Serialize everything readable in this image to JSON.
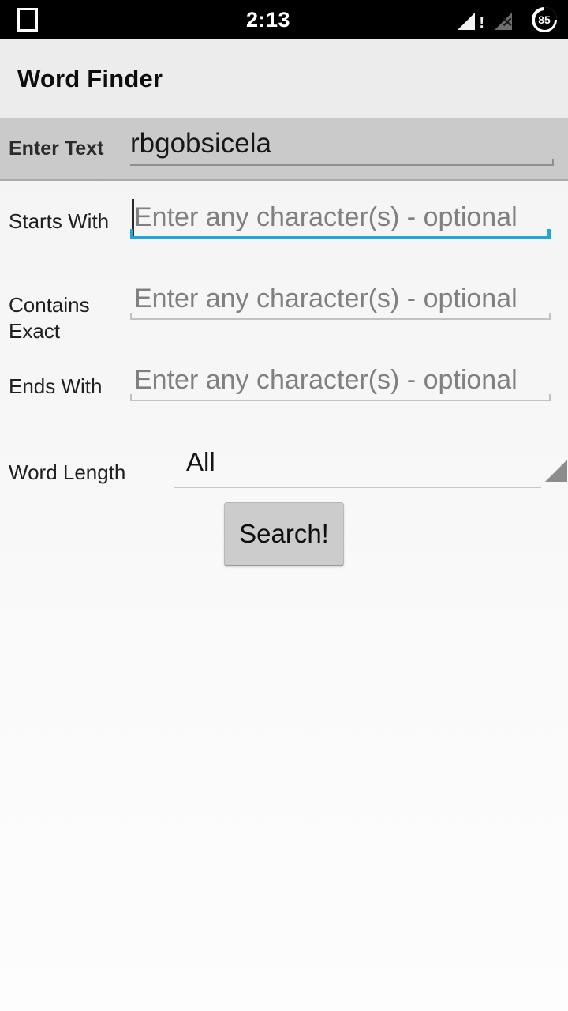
{
  "status_bar": {
    "recents_icon": "square-outline-icon",
    "clock": "2:13",
    "signal_icon": "signal-warning-icon",
    "signal_warning_glyph": "!",
    "signal_secondary_icon": "signal-no-service-icon",
    "signal_secondary_glyph": "✕",
    "battery_icon": "battery-circle-icon",
    "battery_level": "85",
    "background_color": "#000000"
  },
  "action_bar": {
    "title": "Word Finder",
    "background_color": "#ececec"
  },
  "enter_text_row": {
    "label": "Enter Text",
    "value": "rbgobsicela",
    "background_color": "#cacaca"
  },
  "form": {
    "placeholder": "Enter any character(s) - optional",
    "focus_color": "#25a4d8",
    "rows": [
      {
        "label": "Starts With",
        "value": "",
        "focused": true
      },
      {
        "label": "Contains Exact",
        "value": "",
        "focused": false
      },
      {
        "label": "Ends With",
        "value": "",
        "focused": false
      }
    ],
    "word_length": {
      "label": "Word Length",
      "selected": "All",
      "dropdown_icon": "spinner-triangle-icon"
    },
    "search_button": {
      "label": "Search!",
      "background_color": "#cccccc"
    }
  }
}
